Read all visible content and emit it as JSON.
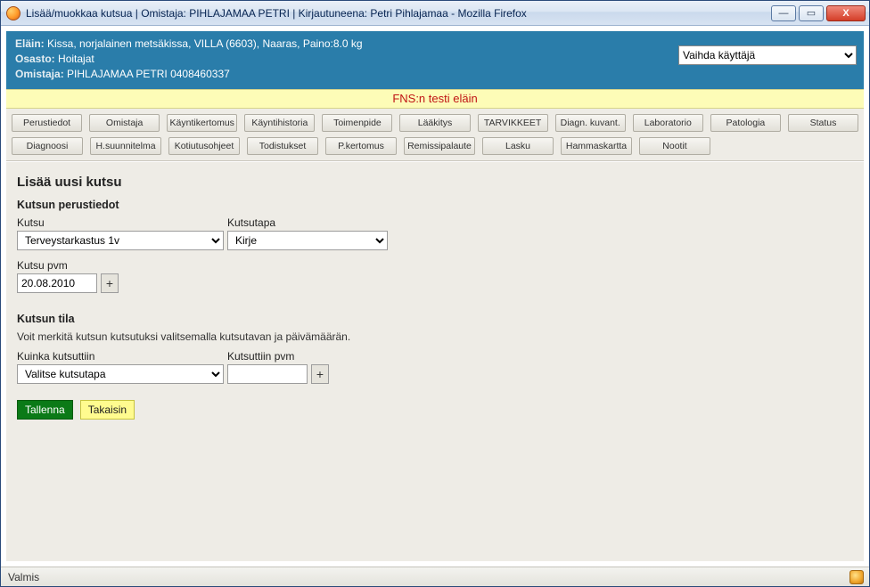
{
  "window": {
    "title": "Lisää/muokkaa kutsua | Omistaja: PIHLAJAMAA PETRI | Kirjautuneena: Petri Pihlajamaa - Mozilla Firefox",
    "btn_min": "—",
    "btn_max": "▭",
    "btn_close": "X"
  },
  "header": {
    "animal_label": "Eläin:",
    "animal_value": "Kissa, norjalainen metsäkissa, VILLA (6603), Naaras, Paino:8.0 kg",
    "dept_label": "Osasto:",
    "dept_value": "Hoitajat",
    "owner_label": "Omistaja:",
    "owner_value": "PIHLAJAMAA PETRI 0408460337",
    "user_switch": "Vaihda käyttäjä"
  },
  "banner": "FNS:n testi eläin",
  "menu": {
    "row1": [
      "Perustiedot",
      "Omistaja",
      "Käyntikertomus",
      "Käyntihistoria",
      "Toimenpide",
      "Lääkitys",
      "TARVIKKEET",
      "Diagn. kuvant.",
      "Laboratorio",
      "Patologia",
      "Status"
    ],
    "row2": [
      "Diagnoosi",
      "H.suunnitelma",
      "Kotiutusohjeet",
      "Todistukset",
      "P.kertomus",
      "Remissipalaute",
      "Lasku",
      "Hammaskartta",
      "Nootit"
    ]
  },
  "form": {
    "title": "Lisää uusi kutsu",
    "section1": "Kutsun perustiedot",
    "kutsu_label": "Kutsu",
    "kutsu_value": "Terveystarkastus 1v",
    "kutsutapa_label": "Kutsutapa",
    "kutsutapa_value": "Kirje",
    "kpvm_label": "Kutsu pvm",
    "kpvm_value": "20.08.2010",
    "plus": "+",
    "section2": "Kutsun tila",
    "help": "Voit merkitä kutsun kutsutuksi valitsemalla kutsutavan ja päivämäärän.",
    "how_label": "Kuinka kutsuttiin",
    "how_value": "Valitse kutsutapa",
    "when_label": "Kutsuttiin pvm",
    "when_value": "",
    "save": "Tallenna",
    "back": "Takaisin"
  },
  "status": "Valmis"
}
